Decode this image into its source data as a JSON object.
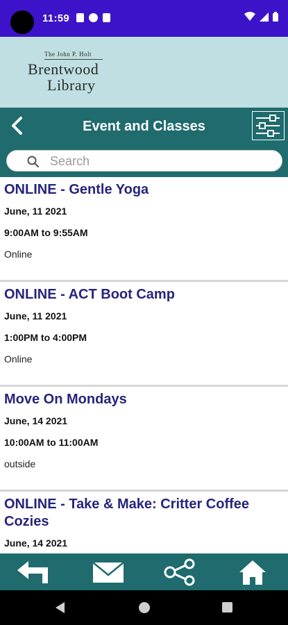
{
  "status_bar": {
    "time": "11:59",
    "icons": [
      "notification-a-icon",
      "notification-f-icon",
      "sd-card-icon",
      "wifi-icon",
      "signal-icon",
      "battery-icon"
    ],
    "background": "#3d13c9"
  },
  "banner": {
    "logo_small": "The John P. Holt",
    "logo_line1": "Brentwood",
    "logo_line2": "Library",
    "background": "#bfdfe2"
  },
  "header": {
    "title": "Event and Classes",
    "back_icon": "chevron-left-icon",
    "filter_icon": "sliders-icon",
    "background": "#1f6b6d"
  },
  "search": {
    "placeholder": "Search",
    "value": ""
  },
  "events": [
    {
      "title": "ONLINE - Gentle Yoga",
      "date": "June, 11 2021",
      "time": "9:00AM to 9:55AM",
      "location": "Online"
    },
    {
      "title": "ONLINE - ACT Boot Camp",
      "date": "June, 11 2021",
      "time": "1:00PM to 4:00PM",
      "location": "Online"
    },
    {
      "title": "Move On Mondays",
      "date": "June, 14 2021",
      "time": "10:00AM to 11:00AM",
      "location": "outside"
    },
    {
      "title": "ONLINE - Take & Make: Critter Coffee Cozies",
      "date": "June, 14 2021",
      "time": "",
      "location": ""
    }
  ],
  "toolbar": {
    "buttons": [
      "reply-arrow-icon",
      "mail-icon",
      "share-icon",
      "home-icon"
    ]
  },
  "colors": {
    "accent": "#1f6b6d",
    "event_title": "#27247c",
    "divider": "#d6d6d6"
  }
}
